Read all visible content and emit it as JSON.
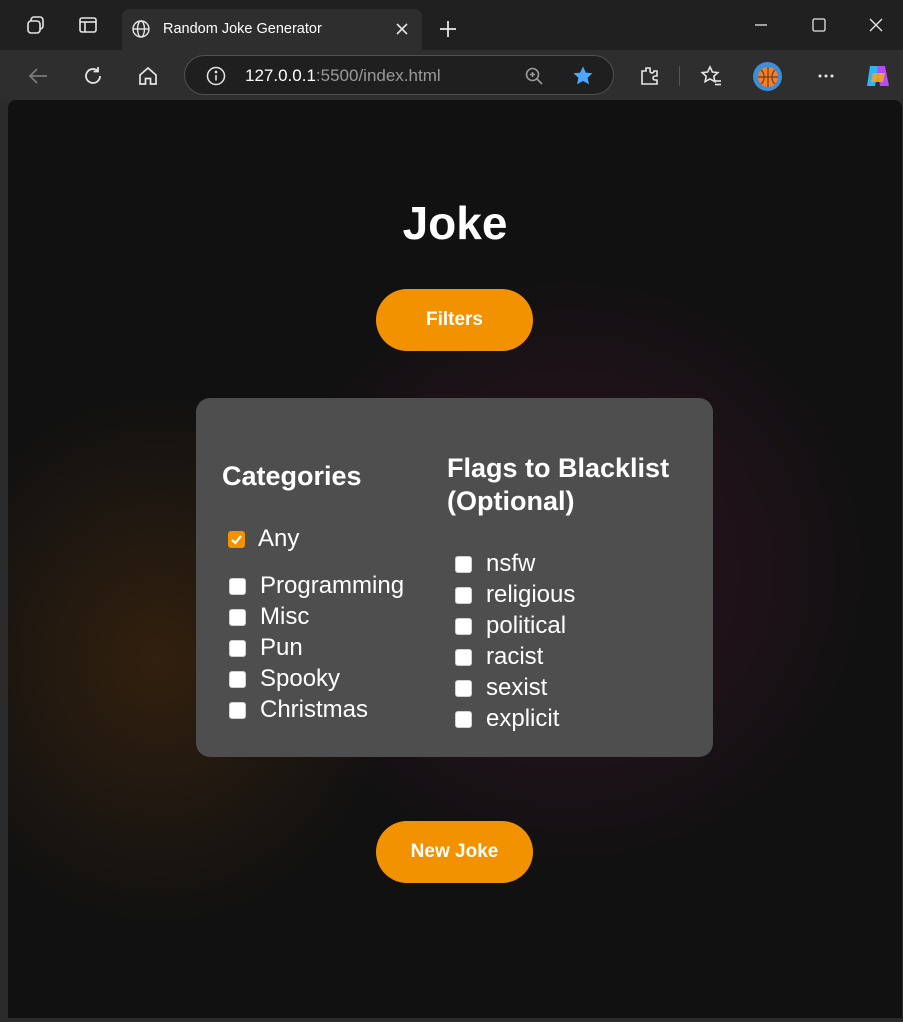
{
  "browser": {
    "tab_title": "Random Joke Generator",
    "url_host": "127.0.0.1",
    "url_rest": ":5500/index.html"
  },
  "page": {
    "title": "Joke",
    "filters_button": "Filters",
    "new_joke_button": "New Joke"
  },
  "filters": {
    "categories_heading": "Categories",
    "any_label": "Any",
    "any_checked": true,
    "categories": [
      {
        "label": "Programming",
        "checked": false
      },
      {
        "label": "Misc",
        "checked": false
      },
      {
        "label": "Pun",
        "checked": false
      },
      {
        "label": "Spooky",
        "checked": false
      },
      {
        "label": "Christmas",
        "checked": false
      }
    ],
    "flags_heading_line1": "Flags to Blacklist",
    "flags_heading_line2": "(Optional)",
    "flags": [
      {
        "label": "nsfw",
        "checked": false
      },
      {
        "label": "religious",
        "checked": false
      },
      {
        "label": "political",
        "checked": false
      },
      {
        "label": "racist",
        "checked": false
      },
      {
        "label": "sexist",
        "checked": false
      },
      {
        "label": "explicit",
        "checked": false
      }
    ]
  },
  "colors": {
    "accent": "#f39200",
    "panel": "#4e4e4e",
    "page_bg": "#111111"
  }
}
